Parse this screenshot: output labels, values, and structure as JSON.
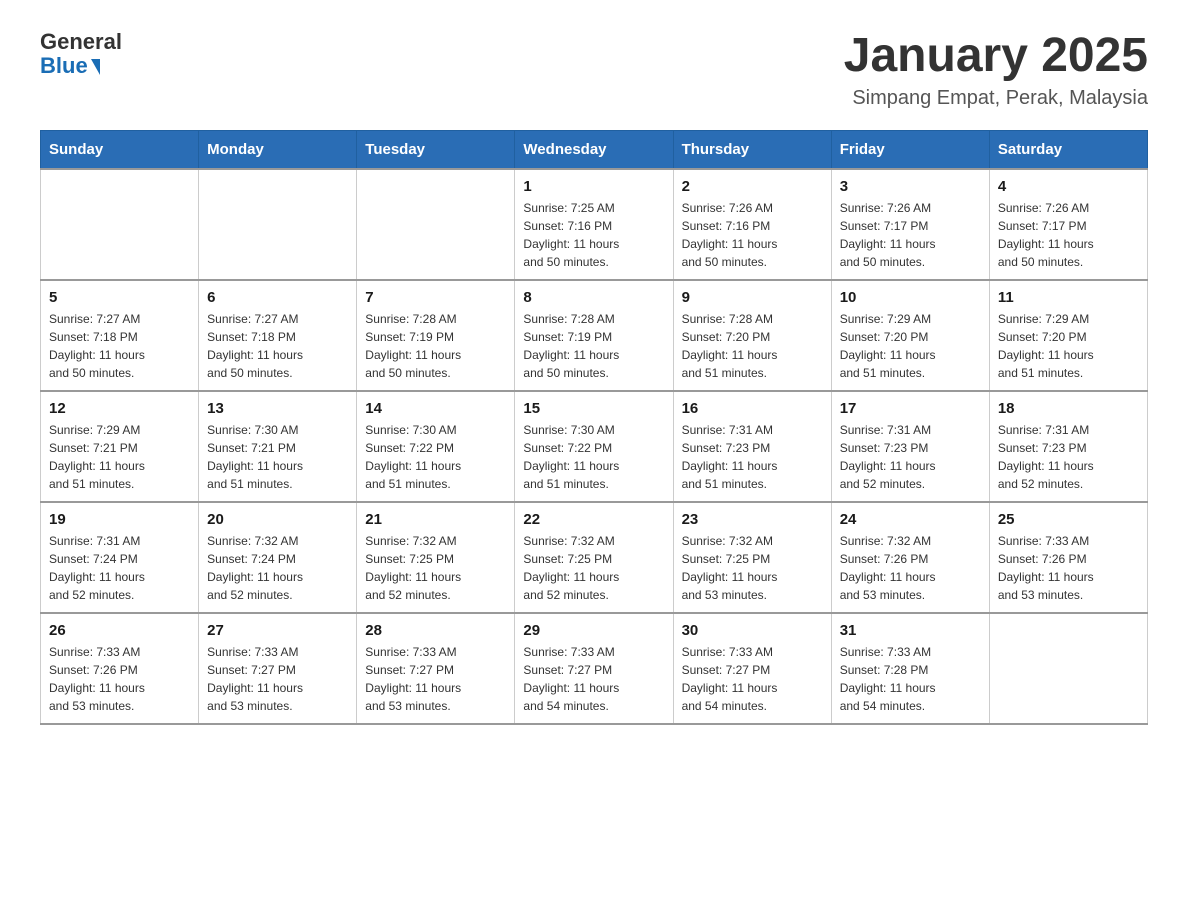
{
  "header": {
    "logo_general": "General",
    "logo_blue": "Blue",
    "month_title": "January 2025",
    "location": "Simpang Empat, Perak, Malaysia"
  },
  "weekdays": [
    "Sunday",
    "Monday",
    "Tuesday",
    "Wednesday",
    "Thursday",
    "Friday",
    "Saturday"
  ],
  "weeks": [
    [
      {
        "day": "",
        "info": ""
      },
      {
        "day": "",
        "info": ""
      },
      {
        "day": "",
        "info": ""
      },
      {
        "day": "1",
        "info": "Sunrise: 7:25 AM\nSunset: 7:16 PM\nDaylight: 11 hours\nand 50 minutes."
      },
      {
        "day": "2",
        "info": "Sunrise: 7:26 AM\nSunset: 7:16 PM\nDaylight: 11 hours\nand 50 minutes."
      },
      {
        "day": "3",
        "info": "Sunrise: 7:26 AM\nSunset: 7:17 PM\nDaylight: 11 hours\nand 50 minutes."
      },
      {
        "day": "4",
        "info": "Sunrise: 7:26 AM\nSunset: 7:17 PM\nDaylight: 11 hours\nand 50 minutes."
      }
    ],
    [
      {
        "day": "5",
        "info": "Sunrise: 7:27 AM\nSunset: 7:18 PM\nDaylight: 11 hours\nand 50 minutes."
      },
      {
        "day": "6",
        "info": "Sunrise: 7:27 AM\nSunset: 7:18 PM\nDaylight: 11 hours\nand 50 minutes."
      },
      {
        "day": "7",
        "info": "Sunrise: 7:28 AM\nSunset: 7:19 PM\nDaylight: 11 hours\nand 50 minutes."
      },
      {
        "day": "8",
        "info": "Sunrise: 7:28 AM\nSunset: 7:19 PM\nDaylight: 11 hours\nand 50 minutes."
      },
      {
        "day": "9",
        "info": "Sunrise: 7:28 AM\nSunset: 7:20 PM\nDaylight: 11 hours\nand 51 minutes."
      },
      {
        "day": "10",
        "info": "Sunrise: 7:29 AM\nSunset: 7:20 PM\nDaylight: 11 hours\nand 51 minutes."
      },
      {
        "day": "11",
        "info": "Sunrise: 7:29 AM\nSunset: 7:20 PM\nDaylight: 11 hours\nand 51 minutes."
      }
    ],
    [
      {
        "day": "12",
        "info": "Sunrise: 7:29 AM\nSunset: 7:21 PM\nDaylight: 11 hours\nand 51 minutes."
      },
      {
        "day": "13",
        "info": "Sunrise: 7:30 AM\nSunset: 7:21 PM\nDaylight: 11 hours\nand 51 minutes."
      },
      {
        "day": "14",
        "info": "Sunrise: 7:30 AM\nSunset: 7:22 PM\nDaylight: 11 hours\nand 51 minutes."
      },
      {
        "day": "15",
        "info": "Sunrise: 7:30 AM\nSunset: 7:22 PM\nDaylight: 11 hours\nand 51 minutes."
      },
      {
        "day": "16",
        "info": "Sunrise: 7:31 AM\nSunset: 7:23 PM\nDaylight: 11 hours\nand 51 minutes."
      },
      {
        "day": "17",
        "info": "Sunrise: 7:31 AM\nSunset: 7:23 PM\nDaylight: 11 hours\nand 52 minutes."
      },
      {
        "day": "18",
        "info": "Sunrise: 7:31 AM\nSunset: 7:23 PM\nDaylight: 11 hours\nand 52 minutes."
      }
    ],
    [
      {
        "day": "19",
        "info": "Sunrise: 7:31 AM\nSunset: 7:24 PM\nDaylight: 11 hours\nand 52 minutes."
      },
      {
        "day": "20",
        "info": "Sunrise: 7:32 AM\nSunset: 7:24 PM\nDaylight: 11 hours\nand 52 minutes."
      },
      {
        "day": "21",
        "info": "Sunrise: 7:32 AM\nSunset: 7:25 PM\nDaylight: 11 hours\nand 52 minutes."
      },
      {
        "day": "22",
        "info": "Sunrise: 7:32 AM\nSunset: 7:25 PM\nDaylight: 11 hours\nand 52 minutes."
      },
      {
        "day": "23",
        "info": "Sunrise: 7:32 AM\nSunset: 7:25 PM\nDaylight: 11 hours\nand 53 minutes."
      },
      {
        "day": "24",
        "info": "Sunrise: 7:32 AM\nSunset: 7:26 PM\nDaylight: 11 hours\nand 53 minutes."
      },
      {
        "day": "25",
        "info": "Sunrise: 7:33 AM\nSunset: 7:26 PM\nDaylight: 11 hours\nand 53 minutes."
      }
    ],
    [
      {
        "day": "26",
        "info": "Sunrise: 7:33 AM\nSunset: 7:26 PM\nDaylight: 11 hours\nand 53 minutes."
      },
      {
        "day": "27",
        "info": "Sunrise: 7:33 AM\nSunset: 7:27 PM\nDaylight: 11 hours\nand 53 minutes."
      },
      {
        "day": "28",
        "info": "Sunrise: 7:33 AM\nSunset: 7:27 PM\nDaylight: 11 hours\nand 53 minutes."
      },
      {
        "day": "29",
        "info": "Sunrise: 7:33 AM\nSunset: 7:27 PM\nDaylight: 11 hours\nand 54 minutes."
      },
      {
        "day": "30",
        "info": "Sunrise: 7:33 AM\nSunset: 7:27 PM\nDaylight: 11 hours\nand 54 minutes."
      },
      {
        "day": "31",
        "info": "Sunrise: 7:33 AM\nSunset: 7:28 PM\nDaylight: 11 hours\nand 54 minutes."
      },
      {
        "day": "",
        "info": ""
      }
    ]
  ]
}
